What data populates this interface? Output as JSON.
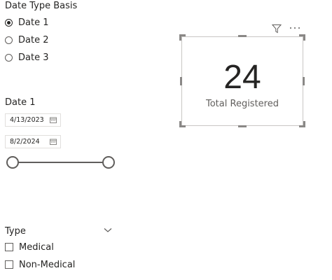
{
  "date_type_slicer": {
    "title": "Date Type Basis",
    "options": [
      {
        "label": "Date 1",
        "selected": true
      },
      {
        "label": "Date 2",
        "selected": false
      },
      {
        "label": "Date 3",
        "selected": false
      }
    ]
  },
  "date_slicer": {
    "title": "Date 1",
    "start_date": "4/13/2023",
    "end_date": "8/2/2024",
    "range_start_fraction": 0,
    "range_end_fraction": 1,
    "icons": {
      "calendar": "calendar-icon"
    }
  },
  "card": {
    "value": "24",
    "label": "Total Registered",
    "header_icons": [
      "filter-icon",
      "more-options-icon"
    ]
  },
  "type_slicer": {
    "title": "Type",
    "options": [
      {
        "label": "Medical",
        "checked": false
      },
      {
        "label": "Non-Medical",
        "checked": false
      }
    ]
  },
  "colors": {
    "text": "#252423",
    "subtle_text": "#605e5c",
    "border": "#c8c6c4"
  }
}
